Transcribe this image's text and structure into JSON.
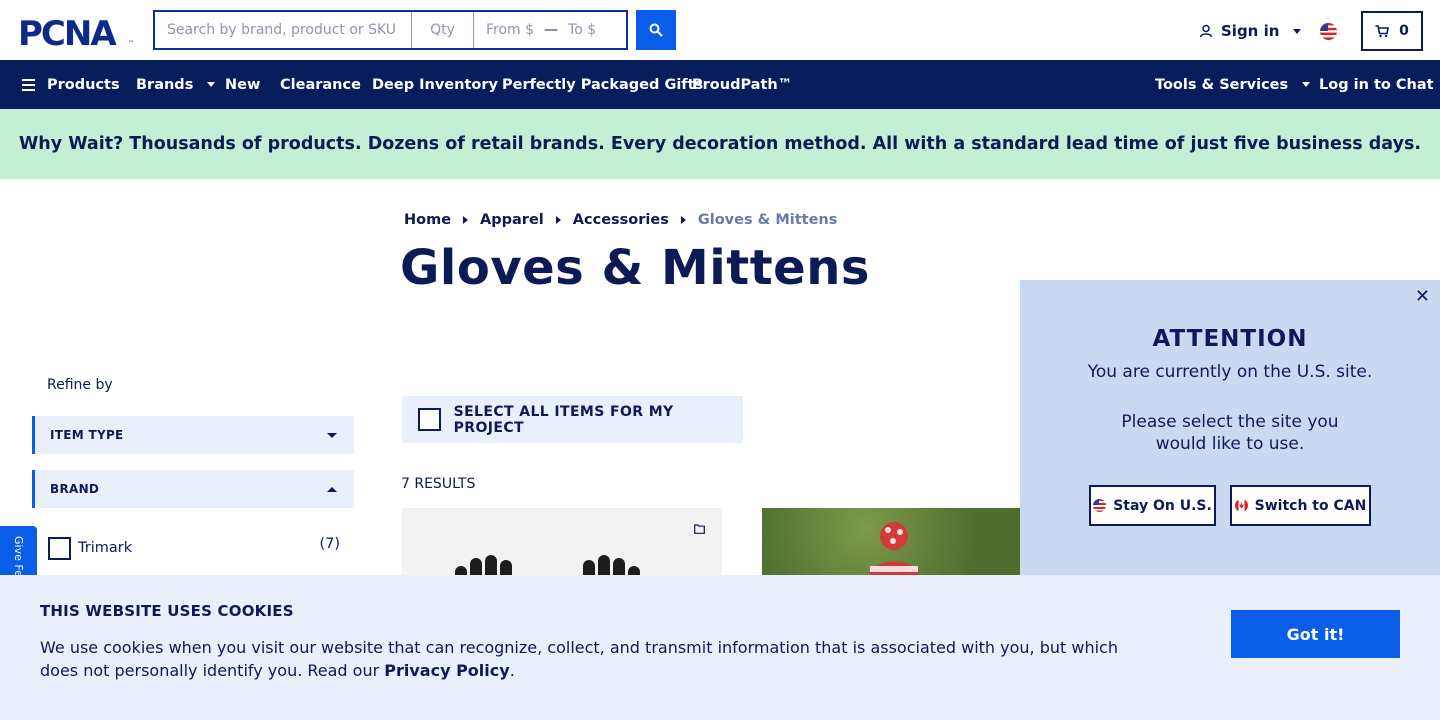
{
  "header": {
    "logo_text": "PCNA",
    "search_placeholder": "Search by brand, product or SKU",
    "qty_placeholder": "Qty",
    "price_from_placeholder": "From $",
    "price_to_placeholder": "To $",
    "sign_in": "Sign in",
    "cart_count": "0"
  },
  "nav": {
    "products": "Products",
    "brands": "Brands",
    "new": "New",
    "clearance": "Clearance",
    "deep_inventory": "Deep Inventory",
    "gifts": "Perfectly Packaged Gifts",
    "proudpath": "ProudPath™",
    "tools": "Tools & Services",
    "chat": "Log in to Chat"
  },
  "banner": "Why Wait? Thousands of products. Dozens of retail brands. Every decoration method. All with a standard lead time of just five business days.",
  "breadcrumb": [
    "Home",
    "Apparel",
    "Accessories",
    "Gloves & Mittens"
  ],
  "page_title": "Gloves & Mittens",
  "sidebar": {
    "refine_label": "Refine by",
    "facets": [
      {
        "label": "ITEM TYPE",
        "expanded": false
      },
      {
        "label": "BRAND",
        "expanded": true
      }
    ],
    "brand_options": [
      {
        "label": "Trimark",
        "count": "(7)"
      }
    ],
    "feedback_tab": "Give Feedback"
  },
  "main": {
    "select_all": "SELECT ALL ITEMS FOR MY PROJECT",
    "results": "7 RESULTS"
  },
  "popup": {
    "title": "ATTENTION",
    "line1": "You are currently on the U.S. site.",
    "line2": "Please select the site you would like to use.",
    "stay_button": "Stay On U.S.",
    "switch_button": "Switch to CAN"
  },
  "cookies": {
    "title": "THIS WEBSITE USES COOKIES",
    "text_before": "We use cookies when you visit our website that can recognize, collect, and transmit information that is associated with you, but which does not personally identify you. Read our ",
    "link": "Privacy Policy",
    "text_after": ".",
    "button": "Got it!"
  },
  "colors": {
    "navy": "#071d5c",
    "accent_blue": "#0a5de8",
    "banner_green": "#c4efd4",
    "popup_bg": "#c9d9f2",
    "light_panel": "#eaf0fb"
  }
}
